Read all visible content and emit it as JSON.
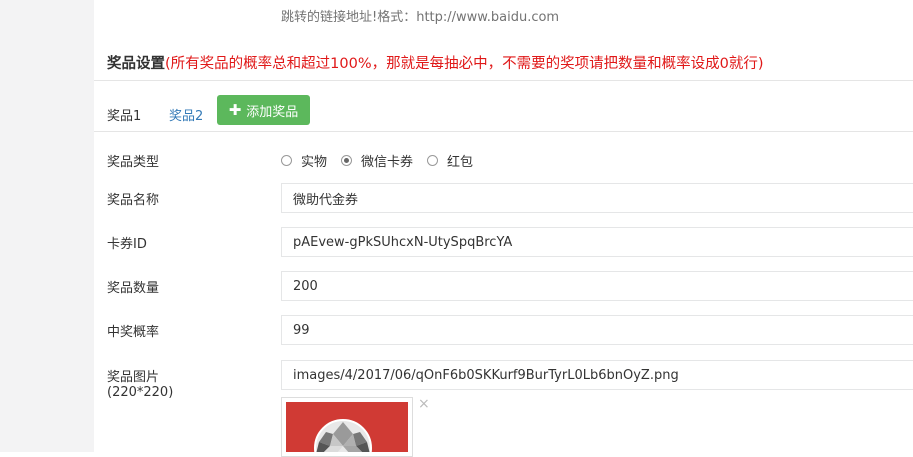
{
  "hint": "跳转的链接地址!格式：http://www.baidu.com",
  "section": {
    "title": "奖品设置",
    "warning": "(所有奖品的概率总和超过100%，那就是每抽必中，不需要的奖项请把数量和概率设成0就行)"
  },
  "tabs": [
    {
      "label": "奖品1"
    },
    {
      "label": "奖品2"
    }
  ],
  "add_button": {
    "label": "添加奖品"
  },
  "form": {
    "type": {
      "label": "奖品类型",
      "options": [
        "实物",
        "微信卡券",
        "红包"
      ],
      "selected": "微信卡券"
    },
    "name": {
      "label": "奖品名称",
      "value": "微助代金券"
    },
    "card_id": {
      "label": "卡券ID",
      "value": "pAEvew-gPkSUhcxN-UtySpqBrcYA"
    },
    "quantity": {
      "label": "奖品数量",
      "value": "200"
    },
    "probability": {
      "label": "中奖概率",
      "value": "99"
    },
    "image": {
      "label": "奖品图片",
      "size_note": "(220*220)",
      "value": "images/4/2017/06/qOnF6b0SKKurf9BurTyrL0Lb6bnOyZ.png",
      "remove_symbol": "×"
    }
  },
  "colors": {
    "warning": "#e01818",
    "add_button": "#5cb85c",
    "tab_link": "#337ab7",
    "thumb_bg": "#d03a34"
  }
}
